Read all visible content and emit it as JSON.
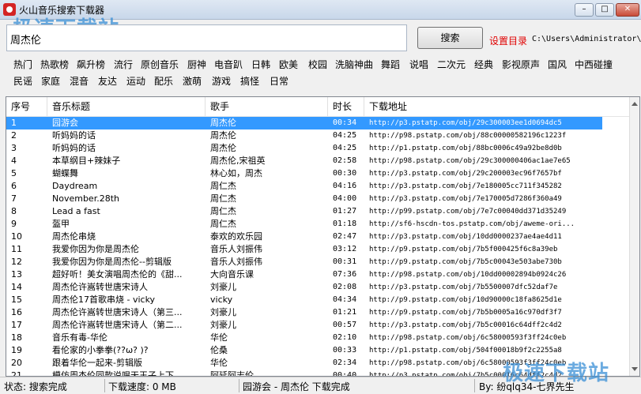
{
  "window": {
    "title": "火山音乐搜索下载器",
    "controls": [
      "minimize-icon",
      "maximize-icon",
      "close-icon"
    ]
  },
  "watermark": {
    "top": "极速下载站",
    "bottom": "极速下载站"
  },
  "search": {
    "value": "周杰伦",
    "button_label": "搜索"
  },
  "settings": {
    "dir_label": "设置目录",
    "dir_path": "C:\\Users\\Administrator\\"
  },
  "categories": [
    "热门",
    "热歌榜",
    "飙升榜",
    "流行",
    "原创音乐",
    "厨神",
    "电音趴",
    "日韩",
    "欧美",
    "校园",
    "洗脑神曲",
    "舞蹈",
    "说唱",
    "二次元",
    "经典",
    "影视原声",
    "国风",
    "中西碰撞",
    "民谣",
    "家庭",
    "混音",
    "友达",
    "运动",
    "配乐",
    "激萌",
    "游戏",
    "搞怪",
    "日常"
  ],
  "table": {
    "headers": [
      "序号",
      "音乐标题",
      "歌手",
      "时长",
      "下载地址"
    ],
    "rows": [
      [
        "1",
        "园游会",
        "周杰伦",
        "00:34",
        "http://p3.pstatp.com/obj/29c300003ee1d0694dc5"
      ],
      [
        "2",
        "听妈妈的话",
        "周杰伦",
        "04:25",
        "http://p98.pstatp.com/obj/88c00000582196c1223f"
      ],
      [
        "3",
        "听妈妈的话",
        "周杰伦",
        "04:25",
        "http://p1.pstatp.com/obj/88bc0006c49a92be8d0b"
      ],
      [
        "4",
        "本草纲目+辣妹子",
        "周杰伦,宋祖英",
        "02:58",
        "http://p98.pstatp.com/obj/29c300000406ac1ae7e65"
      ],
      [
        "5",
        "蝴蝶舞",
        "林心如，周杰",
        "00:30",
        "http://p3.pstatp.com/obj/29c200003ec96f7657bf"
      ],
      [
        "6",
        "Daydream",
        "周仁杰",
        "04:16",
        "http://p3.pstatp.com/obj/7e180005cc711f345282"
      ],
      [
        "7",
        "November.28th",
        "周仁杰",
        "04:00",
        "http://p3.pstatp.com/obj/7e170005d7286f360a49"
      ],
      [
        "8",
        "Lead a fast",
        "周仁杰",
        "01:27",
        "http://p99.pstatp.com/obj/7e7c00040dd371d35249"
      ],
      [
        "9",
        "盔甲",
        "周仁杰",
        "01:18",
        "http://sf6-hscdn-tos.pstatp.com/obj/aweme-ori..."
      ],
      [
        "10",
        "周杰伦串烧",
        "泰欢的欢乐园",
        "02:47",
        "http://p3.pstatp.com/obj/10dd0000237ae4ae4d11"
      ],
      [
        "11",
        "我爱你因为你是周杰伦",
        "音乐人刘振伟",
        "03:12",
        "http://p9.pstatp.com/obj/7b5f000425f6c8a39eb"
      ],
      [
        "12",
        "我爱你因为你是周杰伦--剪辑版",
        "音乐人刘振伟",
        "00:31",
        "http://p9.pstatp.com/obj/7b5c00043e503abe730b"
      ],
      [
        "13",
        "超好听！美女演唱周杰伦的《甜...",
        "大向音乐课",
        "07:36",
        "http://p98.pstatp.com/obj/10dd00002894b0924c26"
      ],
      [
        "14",
        "周杰伦许嵩转世唐宋诗人",
        "刘豪儿",
        "02:08",
        "http://p3.pstatp.com/obj/7b5500007dfc52daf7e"
      ],
      [
        "15",
        "周杰伦17首歌串烧 - vicky",
        "vicky",
        "04:34",
        "http://p9.pstatp.com/obj/10d90000c18fa8625d1e"
      ],
      [
        "16",
        "周杰伦许嵩转世唐宋诗人（第三...",
        "刘豪儿",
        "01:21",
        "http://p9.pstatp.com/obj/7b5b0005a16c970df3f7"
      ],
      [
        "17",
        "周杰伦许嵩转世唐宋诗人（第二...",
        "刘豪儿",
        "00:57",
        "http://p3.pstatp.com/obj/7b5c00016c64dff2c4d2"
      ],
      [
        "18",
        "音乐有毒-华伦",
        "华伦",
        "02:10",
        "http://p98.pstatp.com/obj/6c58000593f3ff24c0eb"
      ],
      [
        "19",
        "看伦家的小拳拳(??ω? )?",
        "伦桑",
        "00:33",
        "http://p1.pstatp.com/obj/504f00018b9f2c2255a8"
      ],
      [
        "20",
        "跟着华伦一起来-剪辑版",
        "华伦",
        "02:34",
        "http://p98.pstatp.com/obj/6c58000593f3ff24c0eb"
      ],
      [
        "21",
        "模仿周杰伦同款说唱天王子上下...",
        "阿延阿志伦",
        "00:40",
        "http://p3.pstatp.com/obj/7b5c00016c64dff2c4d2"
      ]
    ]
  },
  "status": {
    "state": "状态: 搜索完成",
    "speed": "下载速度: 0 MB",
    "now": "园游会 - 周杰伦  下载完成",
    "author": "By: 纷qlq34-七界先生"
  }
}
